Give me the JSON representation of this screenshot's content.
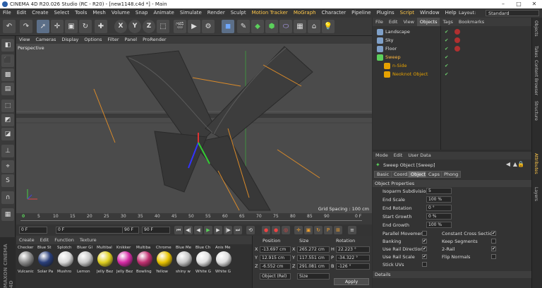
{
  "window": {
    "title": "CINEMA 4D R20.026 Studio (RC - R20) - [new1148.c4d *] - Main",
    "controls": [
      "–",
      "□",
      "✕"
    ]
  },
  "menubar": {
    "items": [
      "File",
      "Edit",
      "Create",
      "Select",
      "Tools",
      "Mesh",
      "Volume",
      "Snap",
      "Animate",
      "Simulate",
      "Render",
      "Sculpt",
      "Motion Tracker",
      "MoGraph",
      "Character",
      "Pipeline",
      "Plugins",
      "Script",
      "Window",
      "Help"
    ],
    "highlighted": [
      "Motion Tracker",
      "MoGraph",
      "Script"
    ],
    "layout_label": "Layout:",
    "layout_value": "Standard"
  },
  "toolbar": {
    "icons": [
      "undo-icon",
      "redo-icon",
      "select-icon",
      "move-icon",
      "scale-icon",
      "rotate-icon",
      "add-icon",
      "x-axis-icon",
      "y-axis-icon",
      "z-axis-icon",
      "coordinate-system-icon",
      "render-view-icon",
      "render-picture-queue-icon",
      "render-settings-icon",
      "cube-icon",
      "pen-icon",
      "subdivision-icon",
      "cloner-icon",
      "deformer-icon",
      "environment-icon",
      "camera-icon",
      "light-icon"
    ],
    "axis_labels": [
      "X",
      "Y",
      "Z"
    ]
  },
  "viewport": {
    "menu": [
      "View",
      "Cameras",
      "Display",
      "Options",
      "Filter",
      "Panel",
      "ProRender"
    ],
    "camera_label": "Perspective",
    "grid_spacing": "Grid Spacing : 100 cm"
  },
  "timeline": {
    "ticks": [
      "0",
      "5",
      "10",
      "15",
      "20",
      "25",
      "30",
      "35",
      "40",
      "45",
      "50",
      "55",
      "60",
      "65",
      "70",
      "75",
      "80",
      "85",
      "90"
    ],
    "current_frame": "0 F",
    "start_frame": "0 F",
    "end_frame": "90 F",
    "max_frame": "90 F",
    "playhead": "0",
    "end_label": "0 F"
  },
  "materials": {
    "menu": [
      "Create",
      "Edit",
      "Function",
      "Texture"
    ],
    "row1": [
      {
        "name": "Checker",
        "color": "#8a8a8a"
      },
      {
        "name": "Blue St",
        "color": "#2a3f7a"
      },
      {
        "name": "Splotch",
        "color": "#d8d8d8"
      },
      {
        "name": "Bluer Gl",
        "color": "#c8c8c8"
      },
      {
        "name": "Multibal",
        "color": "#e0d020"
      },
      {
        "name": "Knikker",
        "color": "#d62aa5"
      },
      {
        "name": "Multiba",
        "color": "#c03070"
      },
      {
        "name": "Chrome",
        "color": "#e8c300"
      },
      {
        "name": "Blue Me",
        "color": "#c6c6c6"
      },
      {
        "name": "Blue Ch",
        "color": "#e0e0e0"
      },
      {
        "name": "Anis Me",
        "color": "#dddddd"
      }
    ],
    "row2": [
      "Vulcanic",
      "Solar Pa",
      "Mushro",
      "Lemon",
      "Jelly Bez",
      "Jelly Bez",
      "Bowling",
      "Yellow",
      "shiny w",
      "White G",
      "White G"
    ]
  },
  "coords": {
    "headers": [
      "Position",
      "Size",
      "Rotation"
    ],
    "rows": [
      {
        "axis": "X",
        "pos": "-13.697 cm",
        "size_axis": "X",
        "size": "265.272 cm",
        "rot_axis": "H",
        "rot": "22.223 °"
      },
      {
        "axis": "Y",
        "pos": "12.915 cm",
        "size_axis": "Y",
        "size": "117.551 cm",
        "rot_axis": "P",
        "rot": "-34.322 °"
      },
      {
        "axis": "Z",
        "pos": "-6.552 cm",
        "size_axis": "Z",
        "size": "291.081 cm",
        "rot_axis": "B",
        "rot": "-126 °"
      }
    ],
    "mode": "Object (Rel)",
    "size_mode": "Size",
    "apply": "Apply"
  },
  "objects": {
    "menu": [
      "File",
      "Edit",
      "View",
      "Objects",
      "Tags",
      "Bookmarks"
    ],
    "items": [
      {
        "name": "Landscape",
        "indent": 0,
        "color": "#7fa0c8",
        "selected": false
      },
      {
        "name": "Sky",
        "indent": 0,
        "color": "#7fa0c8",
        "selected": false
      },
      {
        "name": "Floor",
        "indent": 0,
        "color": "#7fa0c8",
        "selected": false
      },
      {
        "name": "Sweep",
        "indent": 0,
        "color": "#5bd05b",
        "selected": true
      },
      {
        "name": "n-Side",
        "indent": 1,
        "color": "#e6a200",
        "selected": false
      },
      {
        "name": "Neoknot Object",
        "indent": 1,
        "color": "#e6a200",
        "selected": false
      }
    ]
  },
  "right_tabs": [
    "Objects",
    "Takes",
    "Content Browser",
    "Structure",
    "Attributes",
    "Layers"
  ],
  "attributes": {
    "menu": [
      "Mode",
      "Edit",
      "User Data"
    ],
    "title": "Sweep Object [Sweep]",
    "tabs": [
      "Basic",
      "Coord.",
      "Object",
      "Caps",
      "Phong"
    ],
    "active_tab": "Object",
    "section": "Object Properties",
    "fields": [
      {
        "label": "Isoparm Subdivision",
        "value": "5"
      },
      {
        "label": "End Scale",
        "value": "100 %"
      },
      {
        "label": "End Rotation",
        "value": "0 °"
      },
      {
        "label": "Start Growth",
        "value": "0 %"
      },
      {
        "label": "End Growth",
        "value": "100 %"
      }
    ],
    "checks_left": [
      {
        "label": "Parallel Movement",
        "checked": false
      },
      {
        "label": "Banking",
        "checked": true
      },
      {
        "label": "Use Rail Direction",
        "checked": true
      },
      {
        "label": "Use Rail Scale",
        "checked": true
      },
      {
        "label": "Stick UVs",
        "checked": false
      }
    ],
    "checks_right": [
      {
        "label": "Constant Cross Section",
        "checked": true
      },
      {
        "label": "Keep Segments",
        "checked": false
      },
      {
        "label": "2-Rail",
        "checked": true
      },
      {
        "label": "Flip Normals",
        "checked": false
      }
    ],
    "details": "Details"
  },
  "brand": "MAXON CINEMA 4D"
}
